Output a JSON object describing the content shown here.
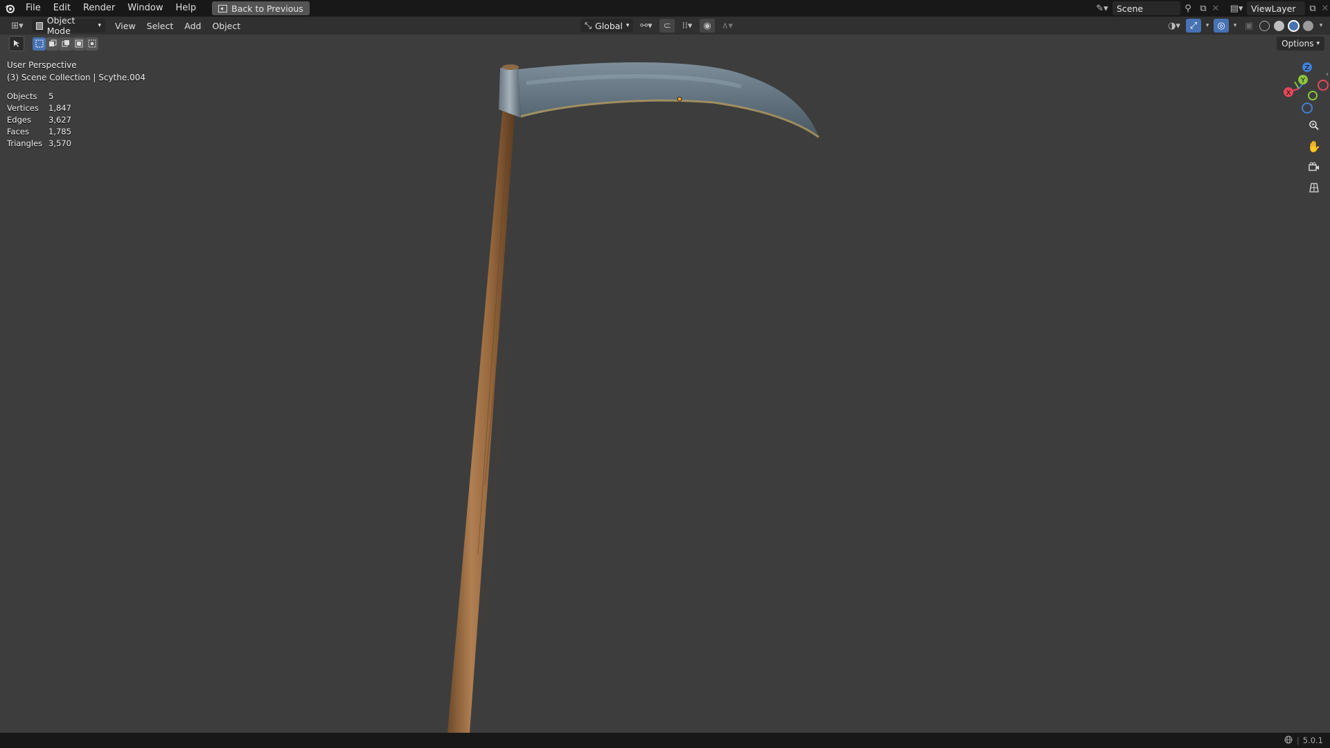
{
  "topbar": {
    "menus": [
      "File",
      "Edit",
      "Render",
      "Window",
      "Help"
    ],
    "back_button": "Back to Previous",
    "scene_name": "Scene",
    "view_layer": "ViewLayer"
  },
  "viewport_header": {
    "mode": "Object Mode",
    "menus": [
      "View",
      "Select",
      "Add",
      "Object"
    ],
    "orientation": "Global"
  },
  "tool_row": {
    "options_label": "Options"
  },
  "overlay": {
    "view_name": "User Perspective",
    "collection_path": "(3) Scene Collection | Scythe.004"
  },
  "stats": [
    {
      "label": "Objects",
      "value": "5"
    },
    {
      "label": "Vertices",
      "value": "1,847"
    },
    {
      "label": "Edges",
      "value": "3,627"
    },
    {
      "label": "Faces",
      "value": "1,785"
    },
    {
      "label": "Triangles",
      "value": "3,570"
    }
  ],
  "gizmo": {
    "x_label": "X",
    "y_label": "Y",
    "z_label": "Z",
    "x_color": "#e8475a",
    "y_color": "#8bc33f",
    "z_color": "#3f7fd6"
  },
  "statusbar": {
    "version": "5.0.1"
  },
  "icons": [
    "blender-logo-icon",
    "back-icon",
    "scene-icon",
    "pin-icon",
    "new-scene-icon",
    "close-icon",
    "view-layer-icon",
    "editor-type-icon",
    "object-mode-icon",
    "transform-orientation-icon",
    "pivot-icon",
    "snap-icon",
    "proportional-edit-icon",
    "visibility-icon",
    "gizmo-icon",
    "overlay-icon",
    "xray-icon",
    "wireframe-shading-icon",
    "solid-shading-icon",
    "material-shading-icon",
    "rendered-shading-icon",
    "select-box-icon",
    "zoom-icon",
    "hand-icon",
    "camera-icon",
    "ortho-grid-icon",
    "globe-icon"
  ]
}
